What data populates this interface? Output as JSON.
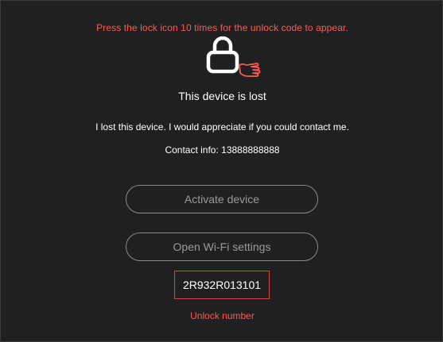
{
  "hint": "Press the lock icon 10 times for the unlock code to appear.",
  "icons": {
    "lock": "lock-icon",
    "hand": "pointing-hand-icon"
  },
  "title": "This device is lost",
  "message": "I lost this device. I would appreciate if you could contact me.",
  "contact": "Contact info: 13888888888",
  "buttons": {
    "activate": "Activate device",
    "wifi": "Open Wi-Fi settings"
  },
  "unlock": {
    "code": "2R932R013101",
    "label": "Unlock number"
  },
  "colors": {
    "background": "#1f2022",
    "accent_red": "#ff5a50",
    "button_border": "#8a8a8c",
    "button_text": "#9a9a9c"
  }
}
